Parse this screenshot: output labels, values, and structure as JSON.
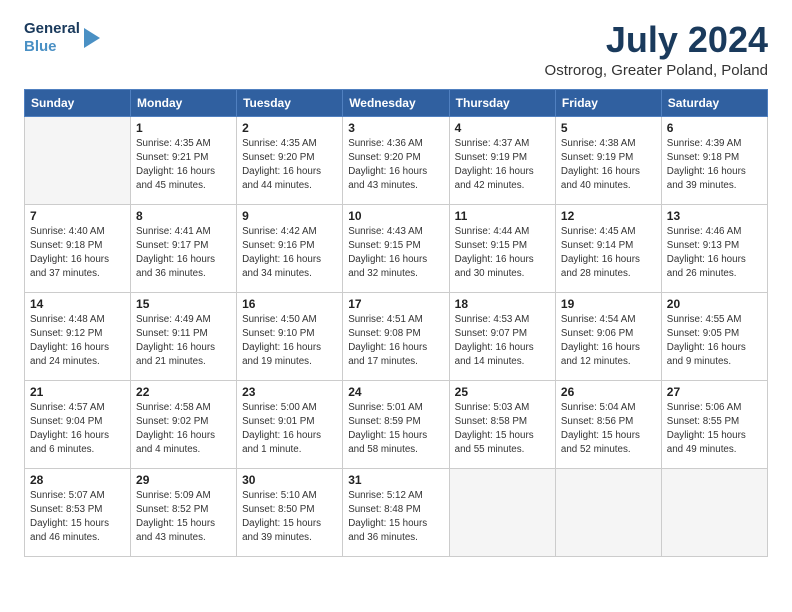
{
  "logo": {
    "line1": "General",
    "line2": "Blue"
  },
  "title": {
    "month_year": "July 2024",
    "location": "Ostrorog, Greater Poland, Poland"
  },
  "days_of_week": [
    "Sunday",
    "Monday",
    "Tuesday",
    "Wednesday",
    "Thursday",
    "Friday",
    "Saturday"
  ],
  "weeks": [
    [
      {
        "day": "",
        "empty": true
      },
      {
        "day": "1",
        "sunrise": "Sunrise: 4:35 AM",
        "sunset": "Sunset: 9:21 PM",
        "daylight": "Daylight: 16 hours and 45 minutes."
      },
      {
        "day": "2",
        "sunrise": "Sunrise: 4:35 AM",
        "sunset": "Sunset: 9:20 PM",
        "daylight": "Daylight: 16 hours and 44 minutes."
      },
      {
        "day": "3",
        "sunrise": "Sunrise: 4:36 AM",
        "sunset": "Sunset: 9:20 PM",
        "daylight": "Daylight: 16 hours and 43 minutes."
      },
      {
        "day": "4",
        "sunrise": "Sunrise: 4:37 AM",
        "sunset": "Sunset: 9:19 PM",
        "daylight": "Daylight: 16 hours and 42 minutes."
      },
      {
        "day": "5",
        "sunrise": "Sunrise: 4:38 AM",
        "sunset": "Sunset: 9:19 PM",
        "daylight": "Daylight: 16 hours and 40 minutes."
      },
      {
        "day": "6",
        "sunrise": "Sunrise: 4:39 AM",
        "sunset": "Sunset: 9:18 PM",
        "daylight": "Daylight: 16 hours and 39 minutes."
      }
    ],
    [
      {
        "day": "7",
        "sunrise": "Sunrise: 4:40 AM",
        "sunset": "Sunset: 9:18 PM",
        "daylight": "Daylight: 16 hours and 37 minutes."
      },
      {
        "day": "8",
        "sunrise": "Sunrise: 4:41 AM",
        "sunset": "Sunset: 9:17 PM",
        "daylight": "Daylight: 16 hours and 36 minutes."
      },
      {
        "day": "9",
        "sunrise": "Sunrise: 4:42 AM",
        "sunset": "Sunset: 9:16 PM",
        "daylight": "Daylight: 16 hours and 34 minutes."
      },
      {
        "day": "10",
        "sunrise": "Sunrise: 4:43 AM",
        "sunset": "Sunset: 9:15 PM",
        "daylight": "Daylight: 16 hours and 32 minutes."
      },
      {
        "day": "11",
        "sunrise": "Sunrise: 4:44 AM",
        "sunset": "Sunset: 9:15 PM",
        "daylight": "Daylight: 16 hours and 30 minutes."
      },
      {
        "day": "12",
        "sunrise": "Sunrise: 4:45 AM",
        "sunset": "Sunset: 9:14 PM",
        "daylight": "Daylight: 16 hours and 28 minutes."
      },
      {
        "day": "13",
        "sunrise": "Sunrise: 4:46 AM",
        "sunset": "Sunset: 9:13 PM",
        "daylight": "Daylight: 16 hours and 26 minutes."
      }
    ],
    [
      {
        "day": "14",
        "sunrise": "Sunrise: 4:48 AM",
        "sunset": "Sunset: 9:12 PM",
        "daylight": "Daylight: 16 hours and 24 minutes."
      },
      {
        "day": "15",
        "sunrise": "Sunrise: 4:49 AM",
        "sunset": "Sunset: 9:11 PM",
        "daylight": "Daylight: 16 hours and 21 minutes."
      },
      {
        "day": "16",
        "sunrise": "Sunrise: 4:50 AM",
        "sunset": "Sunset: 9:10 PM",
        "daylight": "Daylight: 16 hours and 19 minutes."
      },
      {
        "day": "17",
        "sunrise": "Sunrise: 4:51 AM",
        "sunset": "Sunset: 9:08 PM",
        "daylight": "Daylight: 16 hours and 17 minutes."
      },
      {
        "day": "18",
        "sunrise": "Sunrise: 4:53 AM",
        "sunset": "Sunset: 9:07 PM",
        "daylight": "Daylight: 16 hours and 14 minutes."
      },
      {
        "day": "19",
        "sunrise": "Sunrise: 4:54 AM",
        "sunset": "Sunset: 9:06 PM",
        "daylight": "Daylight: 16 hours and 12 minutes."
      },
      {
        "day": "20",
        "sunrise": "Sunrise: 4:55 AM",
        "sunset": "Sunset: 9:05 PM",
        "daylight": "Daylight: 16 hours and 9 minutes."
      }
    ],
    [
      {
        "day": "21",
        "sunrise": "Sunrise: 4:57 AM",
        "sunset": "Sunset: 9:04 PM",
        "daylight": "Daylight: 16 hours and 6 minutes."
      },
      {
        "day": "22",
        "sunrise": "Sunrise: 4:58 AM",
        "sunset": "Sunset: 9:02 PM",
        "daylight": "Daylight: 16 hours and 4 minutes."
      },
      {
        "day": "23",
        "sunrise": "Sunrise: 5:00 AM",
        "sunset": "Sunset: 9:01 PM",
        "daylight": "Daylight: 16 hours and 1 minute."
      },
      {
        "day": "24",
        "sunrise": "Sunrise: 5:01 AM",
        "sunset": "Sunset: 8:59 PM",
        "daylight": "Daylight: 15 hours and 58 minutes."
      },
      {
        "day": "25",
        "sunrise": "Sunrise: 5:03 AM",
        "sunset": "Sunset: 8:58 PM",
        "daylight": "Daylight: 15 hours and 55 minutes."
      },
      {
        "day": "26",
        "sunrise": "Sunrise: 5:04 AM",
        "sunset": "Sunset: 8:56 PM",
        "daylight": "Daylight: 15 hours and 52 minutes."
      },
      {
        "day": "27",
        "sunrise": "Sunrise: 5:06 AM",
        "sunset": "Sunset: 8:55 PM",
        "daylight": "Daylight: 15 hours and 49 minutes."
      }
    ],
    [
      {
        "day": "28",
        "sunrise": "Sunrise: 5:07 AM",
        "sunset": "Sunset: 8:53 PM",
        "daylight": "Daylight: 15 hours and 46 minutes."
      },
      {
        "day": "29",
        "sunrise": "Sunrise: 5:09 AM",
        "sunset": "Sunset: 8:52 PM",
        "daylight": "Daylight: 15 hours and 43 minutes."
      },
      {
        "day": "30",
        "sunrise": "Sunrise: 5:10 AM",
        "sunset": "Sunset: 8:50 PM",
        "daylight": "Daylight: 15 hours and 39 minutes."
      },
      {
        "day": "31",
        "sunrise": "Sunrise: 5:12 AM",
        "sunset": "Sunset: 8:48 PM",
        "daylight": "Daylight: 15 hours and 36 minutes."
      },
      {
        "day": "",
        "empty": true
      },
      {
        "day": "",
        "empty": true
      },
      {
        "day": "",
        "empty": true
      }
    ]
  ]
}
